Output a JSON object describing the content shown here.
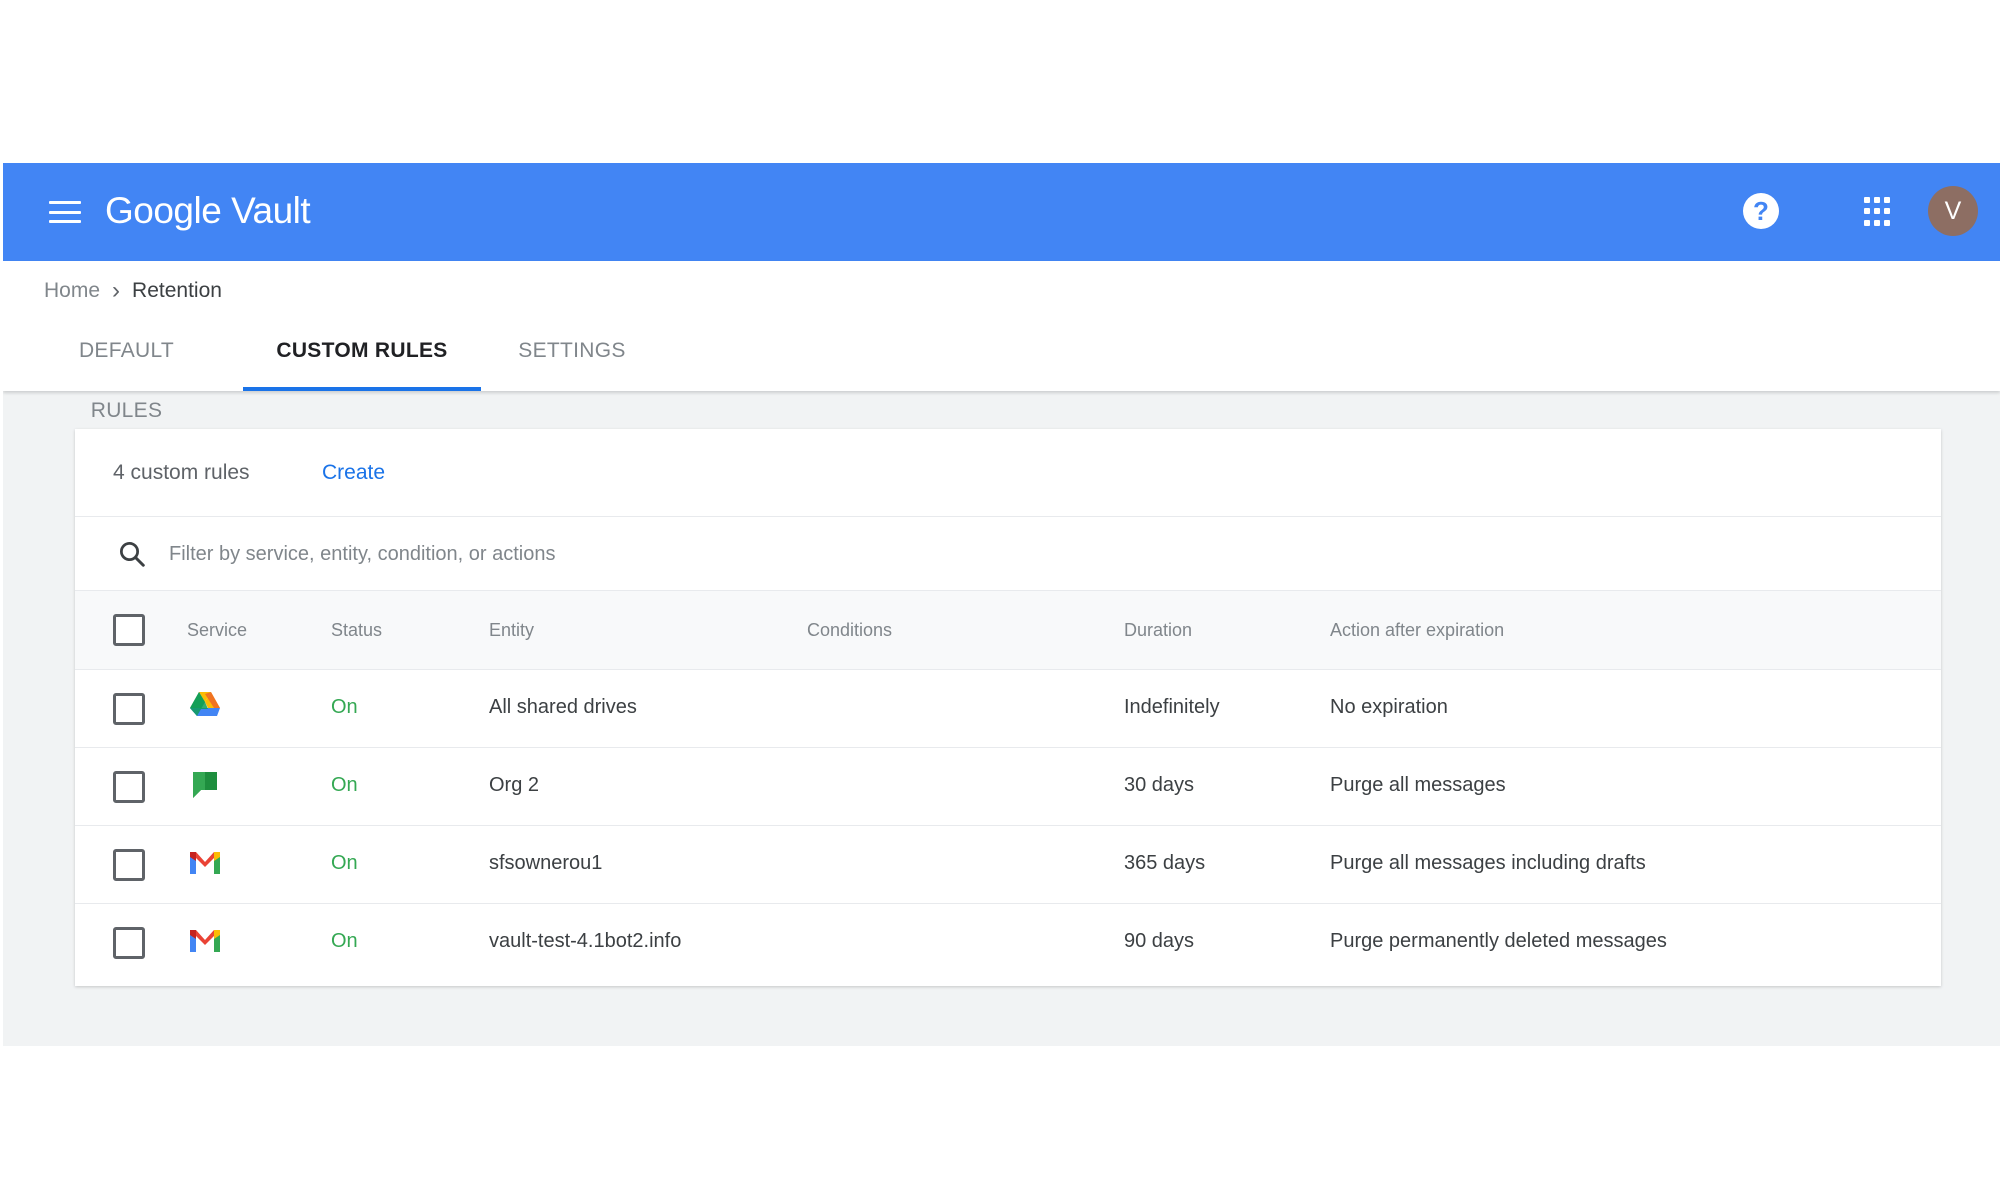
{
  "app": {
    "brand": "Google Vault",
    "avatar_initial": "V"
  },
  "breadcrumb": {
    "home": "Home",
    "current": "Retention"
  },
  "tabs": [
    {
      "label": "DEFAULT RULES",
      "active": false
    },
    {
      "label": "CUSTOM RULES",
      "active": true
    },
    {
      "label": "SETTINGS",
      "active": false
    }
  ],
  "card": {
    "rule_count": "4 custom rules",
    "create_label": "Create",
    "filter_placeholder": "Filter by service, entity, condition, or actions"
  },
  "table": {
    "headers": {
      "service": "Service",
      "status": "Status",
      "entity": "Entity",
      "conditions": "Conditions",
      "duration": "Duration",
      "action": "Action after expiration"
    },
    "rows": [
      {
        "service_icon": "google-drive-icon",
        "status": "On",
        "entity": "All shared drives",
        "conditions": "",
        "duration": "Indefinitely",
        "action": "No expiration"
      },
      {
        "service_icon": "google-chat-icon",
        "status": "On",
        "entity": "Org 2",
        "conditions": "",
        "duration": "30 days",
        "action": "Purge all messages"
      },
      {
        "service_icon": "gmail-icon",
        "status": "On",
        "entity": "sfsownerou1",
        "conditions": "",
        "duration": "365 days",
        "action": "Purge all messages including drafts"
      },
      {
        "service_icon": "gmail-icon",
        "status": "On",
        "entity": "vault-test-4.1bot2.info",
        "conditions": "",
        "duration": "90 days",
        "action": "Purge permanently deleted messages"
      }
    ]
  },
  "colors": {
    "header_bg": "#4285f4",
    "accent": "#1a73e8",
    "status_on": "#34a853",
    "avatar_bg": "#8d6e63"
  }
}
